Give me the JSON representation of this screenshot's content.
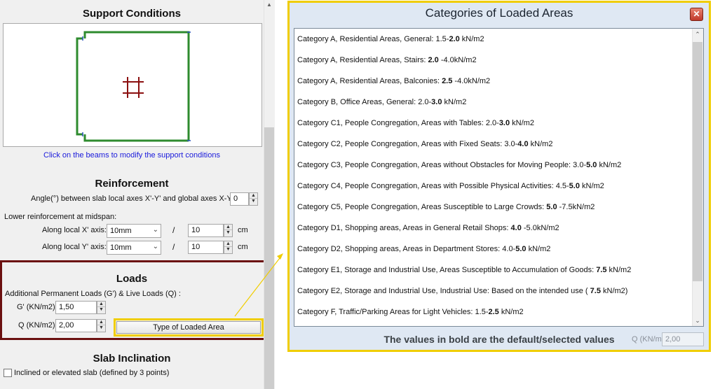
{
  "support": {
    "title": "Support Conditions",
    "hint": "Click on the beams to modify the support conditions"
  },
  "reinforcement": {
    "title": "Reinforcement",
    "angle_label": "Angle(°) between slab local axes X'-Y' and global axes X-Y",
    "angle_value": "0",
    "lower_label": "Lower reinforcement at midspan:",
    "x_axis_label": "Along local X' axis:",
    "y_axis_label": "Along local Y' axis:",
    "x_diameter": "10mm",
    "y_diameter": "10mm",
    "slash": "/",
    "x_spacing": "10",
    "y_spacing": "10",
    "unit": "cm"
  },
  "loads": {
    "title": "Loads",
    "desc": "Additional Permanent Loads (G')  & Live Loads (Q) :",
    "g_label": "G' (KN/m2)",
    "g_value": "1,50",
    "q_label": "Q (KN/m2)",
    "q_value": "2,00",
    "type_button": "Type of Loaded Area"
  },
  "inclination": {
    "title": "Slab Inclination",
    "checkbox_label": "Inclined or elevated slab (defined by 3 points)"
  },
  "dialog": {
    "title": "Categories of Loaded Areas",
    "close": "✕",
    "items": [
      {
        "pre": "Category A, Residential Areas, General:   1.5-",
        "bold": "2.0",
        "post": " kN/m2"
      },
      {
        "pre": "Category A, Residential Areas, Stairs:   ",
        "bold": "2.0",
        "post": " -4.0kN/m2"
      },
      {
        "pre": "Category A, Residential Areas, Balconies:   ",
        "bold": "2.5",
        "post": " -4.0kN/m2"
      },
      {
        "pre": "Category B,  Office Areas, General:   2.0-",
        "bold": "3.0",
        "post": " kN/m2"
      },
      {
        "pre": "Category C1, People Congregation, Areas with Tables:   2.0-",
        "bold": "3.0",
        "post": " kN/m2"
      },
      {
        "pre": "Category C2, People Congregation, Areas with Fixed Seats:   3.0-",
        "bold": "4.0",
        "post": " kN/m2"
      },
      {
        "pre": "Category C3, People Congregation, Areas without Obstacles for Moving People:   3.0-",
        "bold": "5.0",
        "post": " kN/m2"
      },
      {
        "pre": "Category C4, People Congregation, Areas with Possible Physical Activities:   4.5-",
        "bold": "5.0",
        "post": " kN/m2"
      },
      {
        "pre": "Category C5, People Congregation, Areas Susceptible to Large Crowds:   ",
        "bold": "5.0",
        "post": " -7.5kN/m2"
      },
      {
        "pre": "Category D1,  Shopping  areas, Areas in General Retail Shops:   ",
        "bold": "4.0",
        "post": " -5.0kN/m2"
      },
      {
        "pre": "Category D2,  Shopping  areas, Areas in Department Stores:   4.0-",
        "bold": "5.0",
        "post": " kN/m2"
      },
      {
        "pre": "Category E1,  Storage and Industrial Use, Areas Susceptible to Accumulation  of Goods:   ",
        "bold": "7.5",
        "post": " kN/m2"
      },
      {
        "pre": "Category E2,  Storage and Industrial Use, Industrial Use:   Based on the intended use ( ",
        "bold": "7.5",
        "post": " kN/m2)"
      },
      {
        "pre": "Category F,  Traffic/Parking Areas for Light Vehicles:   1.5-",
        "bold": "2.5",
        "post": " kN/m2"
      }
    ],
    "footer": "The values in bold are the default/selected values",
    "ghost_q_label": "Q (KN/m2)",
    "ghost_q_value": "2,00"
  },
  "colors": {
    "accent_yellow": "#f0cd00",
    "loads_border": "#6b1010",
    "beam_green": "#2e8b2e",
    "column_red": "#8b1010",
    "hint_blue": "#1a1adb"
  }
}
